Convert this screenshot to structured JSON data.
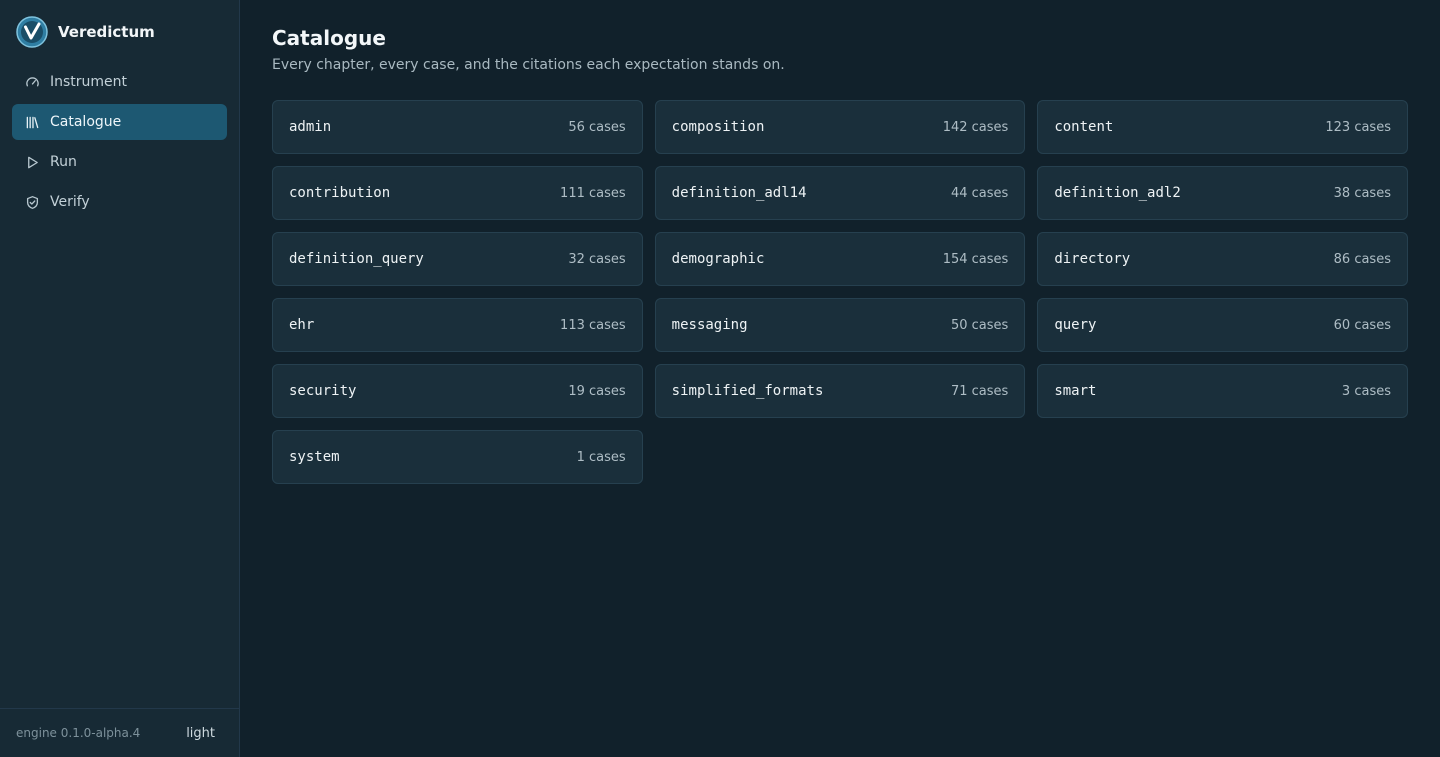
{
  "brand": {
    "name": "Veredictum"
  },
  "nav": [
    {
      "label": "Instrument",
      "icon": "gauge-icon",
      "active": false
    },
    {
      "label": "Catalogue",
      "icon": "library-icon",
      "active": true
    },
    {
      "label": "Run",
      "icon": "play-icon",
      "active": false
    },
    {
      "label": "Verify",
      "icon": "shield-check-icon",
      "active": false
    }
  ],
  "footer": {
    "engine_version": "engine 0.1.0-alpha.4",
    "theme_toggle": "light"
  },
  "page": {
    "title": "Catalogue",
    "subtitle": "Every chapter, every case, and the citations each expectation stands on."
  },
  "chapters": [
    {
      "name": "admin",
      "count": "56 cases"
    },
    {
      "name": "composition",
      "count": "142 cases"
    },
    {
      "name": "content",
      "count": "123 cases"
    },
    {
      "name": "contribution",
      "count": "111 cases"
    },
    {
      "name": "definition_adl14",
      "count": "44 cases"
    },
    {
      "name": "definition_adl2",
      "count": "38 cases"
    },
    {
      "name": "definition_query",
      "count": "32 cases"
    },
    {
      "name": "demographic",
      "count": "154 cases"
    },
    {
      "name": "directory",
      "count": "86 cases"
    },
    {
      "name": "ehr",
      "count": "113 cases"
    },
    {
      "name": "messaging",
      "count": "50 cases"
    },
    {
      "name": "query",
      "count": "60 cases"
    },
    {
      "name": "security",
      "count": "19 cases"
    },
    {
      "name": "simplified_formats",
      "count": "71 cases"
    },
    {
      "name": "smart",
      "count": "3 cases"
    },
    {
      "name": "system",
      "count": "1 cases"
    }
  ],
  "colors": {
    "background": "#11212b",
    "sidebar": "#172a35",
    "active_nav": "#1d5872",
    "card": "#1a2f3b",
    "logo_accent": "#3f8fb4"
  }
}
